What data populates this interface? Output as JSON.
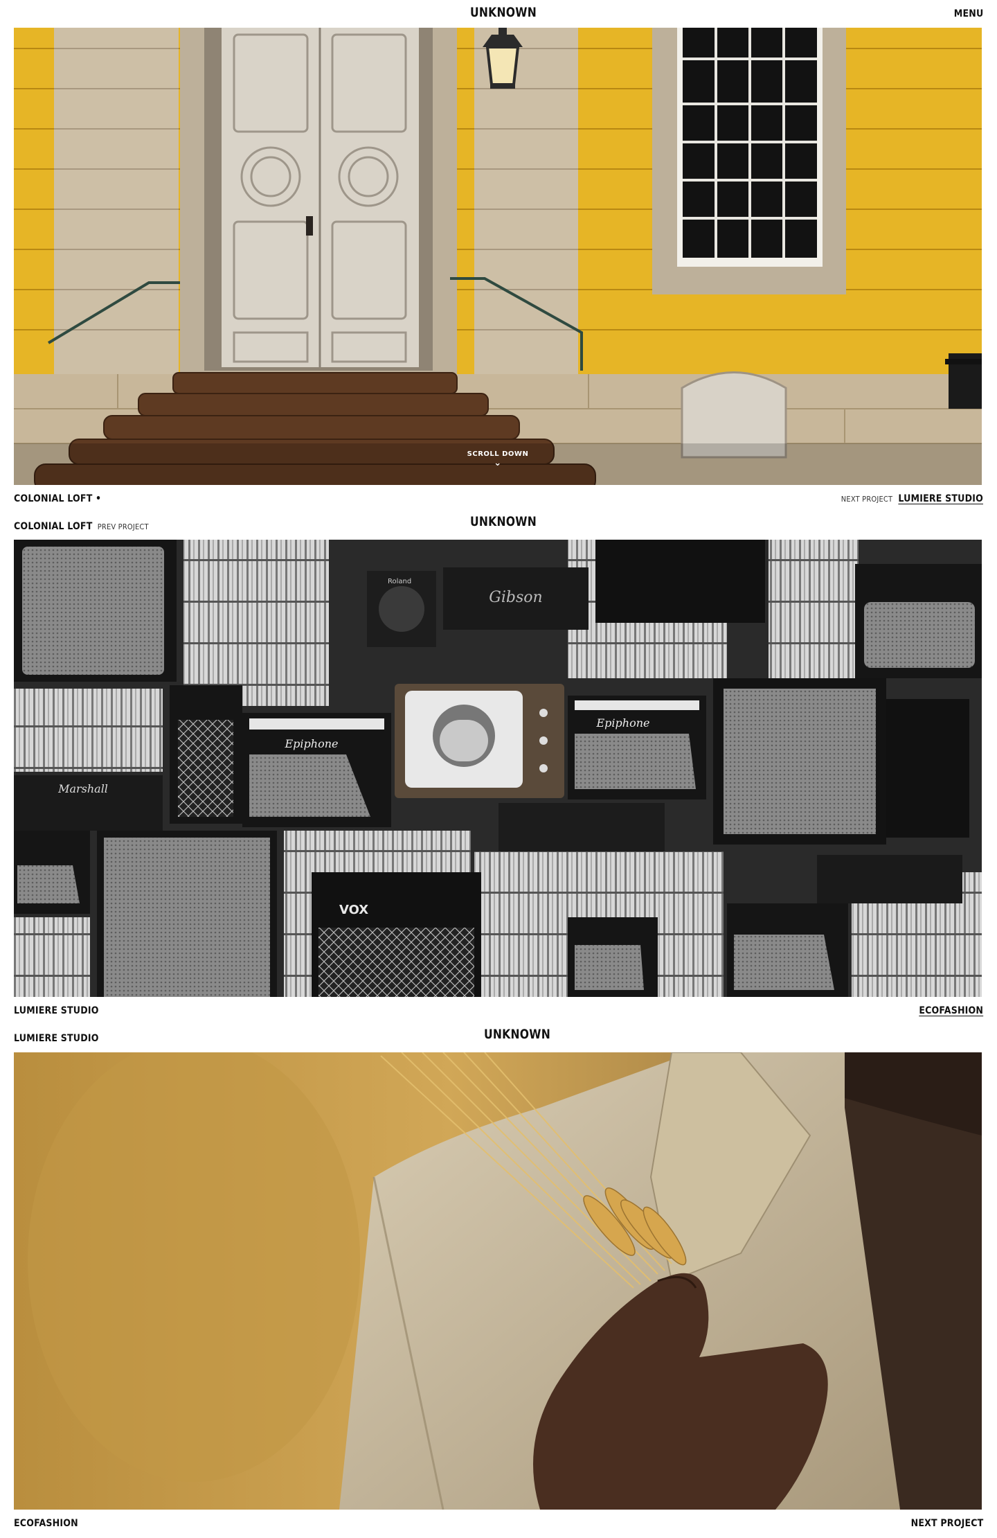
{
  "header": {
    "brand": "UNKNOWN",
    "menu_label": "MENU"
  },
  "section1": {
    "scroll_down": "SCROLL DOWN",
    "project_title": "COLONIAL LOFT •",
    "next_label": "NEXT PROJECT",
    "next_title": "LUMIERE STUDIO"
  },
  "section2": {
    "prev_title": "COLONIAL LOFT",
    "prev_label": "PREV PROJECT",
    "brand": "UNKNOWN",
    "project_title": "LUMIERE STUDIO",
    "next_title": "ECOFASHION",
    "amp_brands": [
      "Gibson",
      "Epiphone",
      "Marshall",
      "VOX",
      "Roland"
    ]
  },
  "section3": {
    "prev_title": "LUMIERE STUDIO",
    "brand": "UNKNOWN",
    "project_title": "ECOFASHION",
    "next_label": "NEXT PROJECT"
  },
  "colors": {
    "background": "#ffffff",
    "text": "#111111",
    "facade_yellow": "#e6b526",
    "wheat": "#c49a4a"
  }
}
